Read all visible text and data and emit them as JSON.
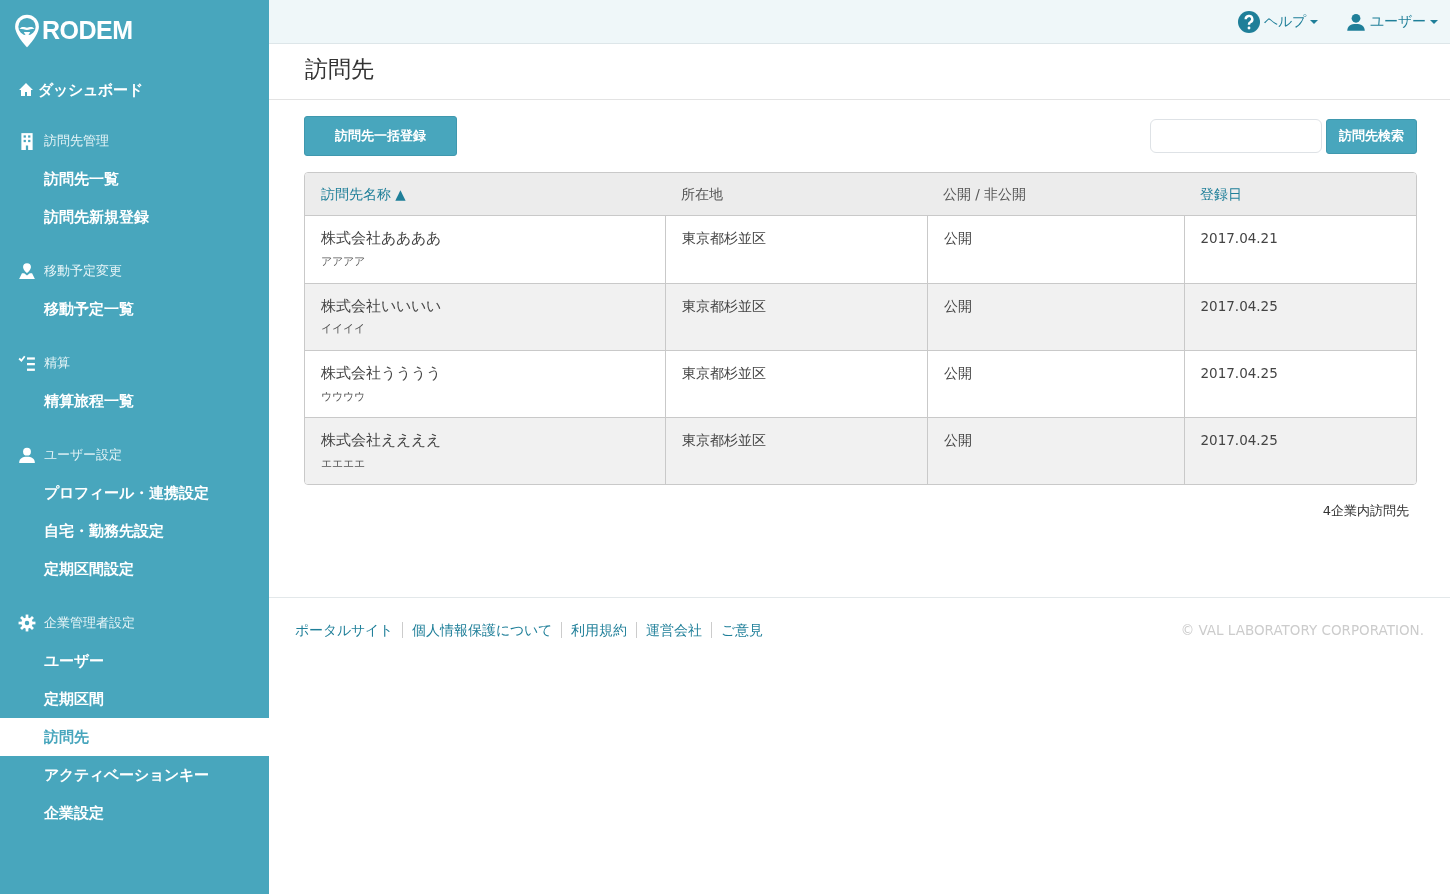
{
  "sidebar": {
    "logo": "RODEM",
    "dashboard": {
      "label": "ダッシュボード"
    },
    "groups": [
      {
        "title": "訪問先管理",
        "items": [
          {
            "label": "訪問先一覧",
            "selected": false
          },
          {
            "label": "訪問先新規登録",
            "selected": false
          }
        ]
      },
      {
        "title": "移動予定変更",
        "items": [
          {
            "label": "移動予定一覧",
            "selected": false
          }
        ]
      },
      {
        "title": "精算",
        "items": [
          {
            "label": "精算旅程一覧",
            "selected": false
          }
        ]
      },
      {
        "title": "ユーザー設定",
        "items": [
          {
            "label": "プロフィール・連携設定",
            "selected": false
          },
          {
            "label": "自宅・勤務先設定",
            "selected": false
          },
          {
            "label": "定期区間設定",
            "selected": false
          }
        ]
      },
      {
        "title": "企業管理者設定",
        "items": [
          {
            "label": "ユーザー",
            "selected": false
          },
          {
            "label": "定期区間",
            "selected": false
          },
          {
            "label": "訪問先",
            "selected": true
          },
          {
            "label": "アクティベーションキー",
            "selected": false
          },
          {
            "label": "企業設定",
            "selected": false
          }
        ]
      }
    ]
  },
  "header": {
    "help": "ヘルプ",
    "user": "ユーザー"
  },
  "page_title": "訪問先",
  "bulk_button": "訪問先一括登録",
  "search": {
    "button": "訪問先検索"
  },
  "table": {
    "columns": [
      {
        "label": "訪問先名称",
        "sortable": true,
        "sort": "▲"
      },
      {
        "label": "所在地",
        "sortable": false
      },
      {
        "label": "公開 / 非公開",
        "sortable": false
      },
      {
        "label": "登録日",
        "sortable": true
      }
    ],
    "rows": [
      {
        "name": "株式会社ああああ",
        "kana": "アアアア",
        "address": "東京都杉並区",
        "visibility": "公開",
        "date": "2017.04.21"
      },
      {
        "name": "株式会社いいいい",
        "kana": "イイイイ",
        "address": "東京都杉並区",
        "visibility": "公開",
        "date": "2017.04.25"
      },
      {
        "name": "株式会社うううう",
        "kana": "ウウウウ",
        "address": "東京都杉並区",
        "visibility": "公開",
        "date": "2017.04.25"
      },
      {
        "name": "株式会社ええええ",
        "kana": "エエエエ",
        "address": "東京都杉並区",
        "visibility": "公開",
        "date": "2017.04.25"
      }
    ]
  },
  "count": "4企業内訪問先",
  "footer": {
    "links": [
      "ポータルサイト",
      "個人情報保護について",
      "利用規約",
      "運営会社",
      "ご意見"
    ],
    "copyright": "© VAL LABORATORY CORPORATION."
  }
}
